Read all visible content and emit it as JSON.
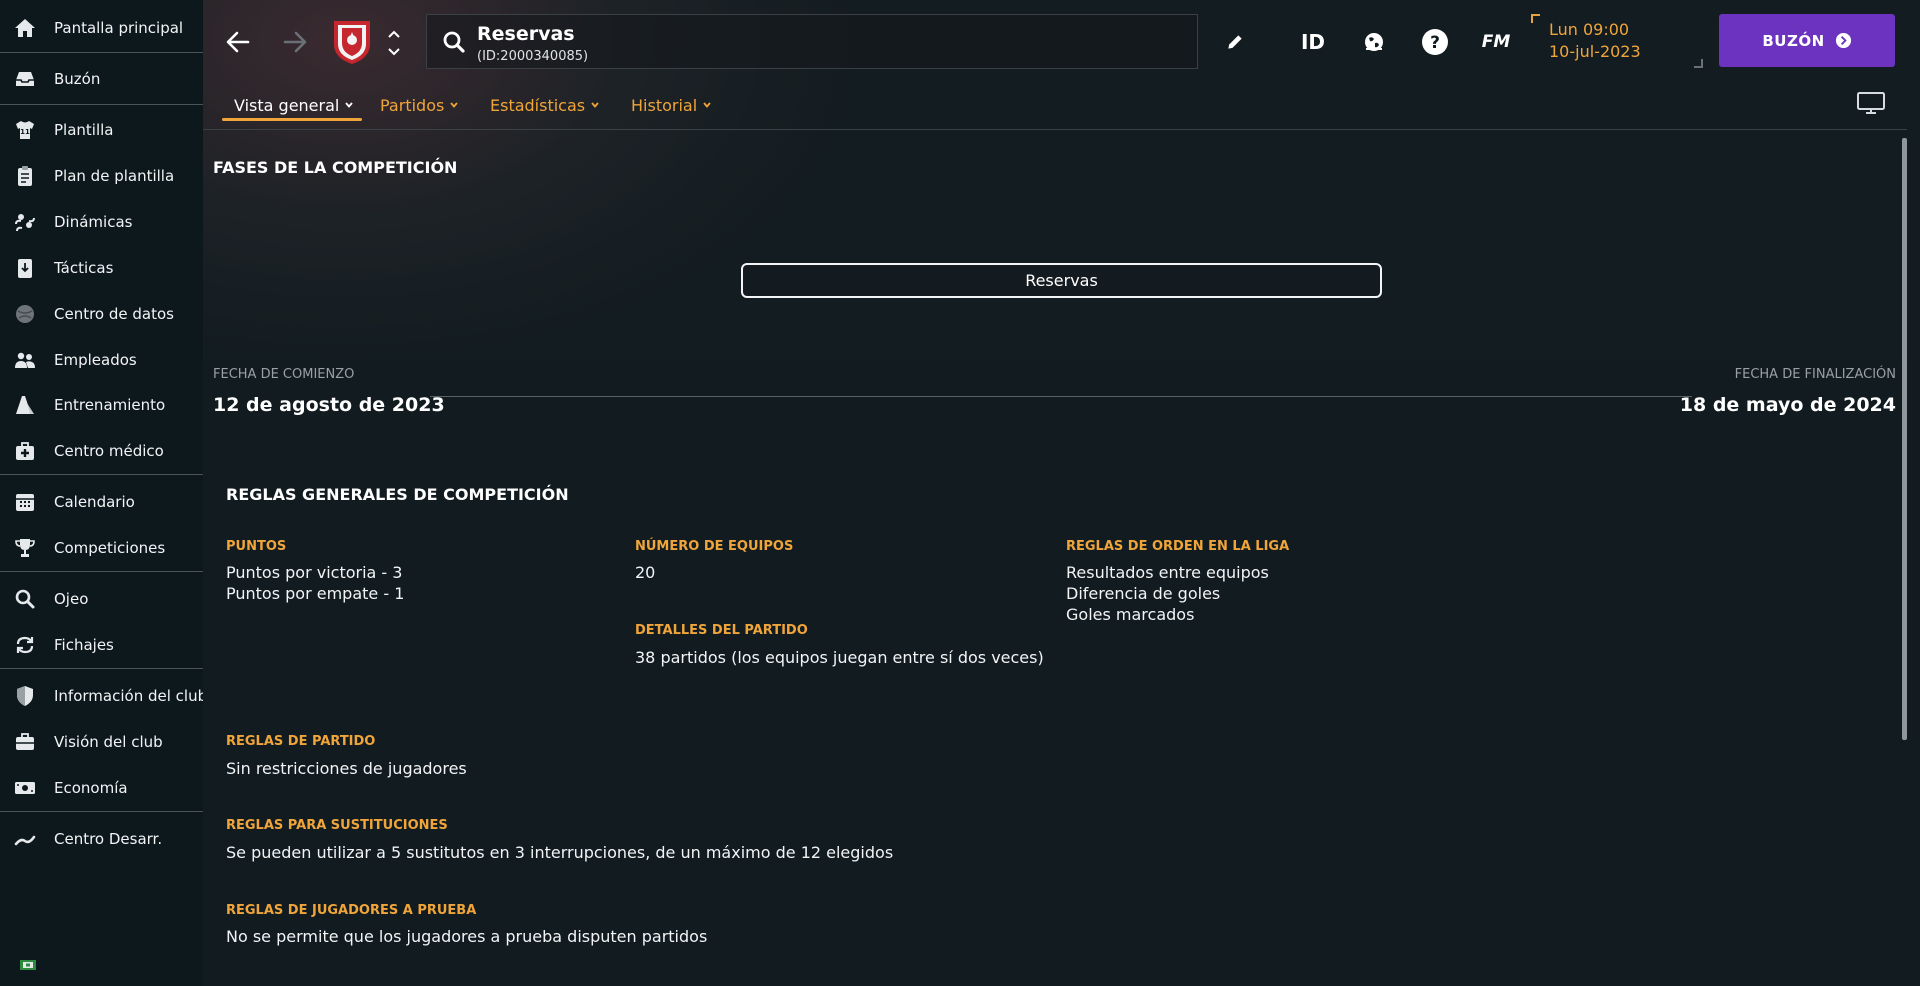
{
  "sidebar": {
    "items": [
      {
        "label": "Pantalla principal",
        "icon": "home-icon"
      },
      {
        "label": "Buzón",
        "icon": "inbox-icon"
      },
      {
        "label": "Plantilla",
        "icon": "shirt-icon"
      },
      {
        "label": "Plan de plantilla",
        "icon": "clipboard-icon"
      },
      {
        "label": "Dinámicas",
        "icon": "people-cycle-icon"
      },
      {
        "label": "Tácticas",
        "icon": "tactics-board-icon"
      },
      {
        "label": "Centro de datos",
        "icon": "data-sphere-icon"
      },
      {
        "label": "Empleados",
        "icon": "staff-icon"
      },
      {
        "label": "Entrenamiento",
        "icon": "training-cone-icon"
      },
      {
        "label": "Centro médico",
        "icon": "medical-kit-icon"
      },
      {
        "label": "Calendario",
        "icon": "calendar-icon"
      },
      {
        "label": "Competiciones",
        "icon": "trophy-icon"
      },
      {
        "label": "Ojeo",
        "icon": "magnifier-icon"
      },
      {
        "label": "Fichajes",
        "icon": "transfer-arrows-icon"
      },
      {
        "label": "Información del club",
        "icon": "shield-icon"
      },
      {
        "label": "Visión del club",
        "icon": "briefcase-icon"
      },
      {
        "label": "Economía",
        "icon": "banknote-icon"
      },
      {
        "label": "Centro Desarr.",
        "icon": "growth-chart-icon"
      }
    ]
  },
  "header": {
    "title": "Reservas",
    "subtitle": "(ID:2000340085)",
    "id_label": "ID",
    "fm_label": "FM",
    "date_time": "Lun 09:00",
    "date": "10-jul-2023",
    "inbox_label": "BUZÓN"
  },
  "tabs": [
    {
      "label": "Vista general",
      "active": true
    },
    {
      "label": "Partidos",
      "active": false
    },
    {
      "label": "Estadísticas",
      "active": false
    },
    {
      "label": "Historial",
      "active": false
    }
  ],
  "phases": {
    "heading": "FASES DE LA COMPETICIÓN",
    "stage_button": "Reservas",
    "start_label": "FECHA DE COMIENZO",
    "start_date": "12 de agosto de 2023",
    "end_label": "FECHA DE FINALIZACIÓN",
    "end_date": "18 de mayo de 2024"
  },
  "rules": {
    "heading": "REGLAS GENERALES DE COMPETICIÓN",
    "points_label": "PUNTOS",
    "points_win": "Puntos por victoria - 3",
    "points_draw": "Puntos por empate - 1",
    "teams_label": "NÚMERO DE EQUIPOS",
    "teams_value": "20",
    "match_details_label": "DETALLES DEL PARTIDO",
    "match_details_value": "38 partidos (los equipos juegan entre sí dos veces)",
    "order_label": "REGLAS DE ORDEN EN LA LIGA",
    "order_1": "Resultados entre equipos",
    "order_2": "Diferencia de goles",
    "order_3": "Goles marcados",
    "match_rules_label": "REGLAS DE PARTIDO",
    "match_rules_value": "Sin restricciones de jugadores",
    "subs_label": "REGLAS PARA SUSTITUCIONES",
    "subs_value": "Se pueden utilizar a 5 sustitutos en 3 interrupciones, de un máximo de 12 elegidos",
    "trial_label": "REGLAS DE JUGADORES A PRUEBA",
    "trial_value": "No se permite que los jugadores a prueba disputen partidos"
  },
  "colors": {
    "accent": "#f0a53a",
    "inbox_button": "#6b33bf",
    "background": "#111b20"
  }
}
